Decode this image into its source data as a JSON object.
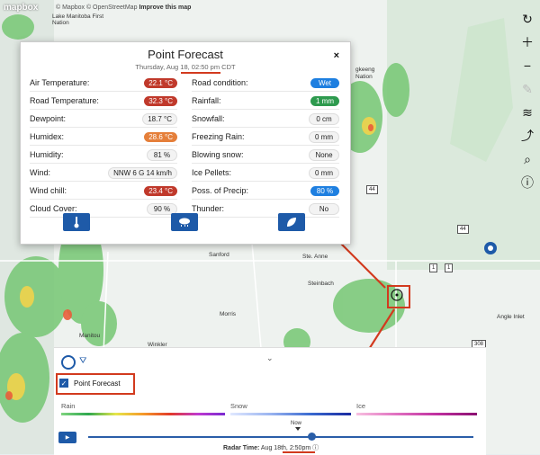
{
  "map": {
    "logo_text": "mapbox",
    "attribution": "© Mapbox © OpenStreetMap",
    "improve_link": "Improve this map",
    "towns": [
      {
        "name": "Lake Manitoba First Nation"
      },
      {
        "name": "Sanford"
      },
      {
        "name": "Ste. Anne"
      },
      {
        "name": "Steinbach"
      },
      {
        "name": "Morris"
      },
      {
        "name": "Manitou"
      },
      {
        "name": "Winkler"
      },
      {
        "name": "Angle Inlet"
      },
      {
        "name": "Nation"
      },
      {
        "name": "gkeeng"
      }
    ],
    "shields": [
      "44",
      "44",
      "1",
      "1",
      "308"
    ]
  },
  "toolbar": {
    "icons": [
      "refresh-icon",
      "zoom-in-icon",
      "zoom-out-icon",
      "pencil-icon",
      "layers-icon",
      "route-icon",
      "search-icon",
      "info-icon"
    ]
  },
  "forecast": {
    "title": "Point Forecast",
    "subtitle": "Thursday, Aug 18, 02:50 pm CDT",
    "close_label": "×",
    "left_rows": [
      {
        "label": "Air Temperature:",
        "value": "22.1 °C",
        "style": "red"
      },
      {
        "label": "Road Temperature:",
        "value": "32.3 °C",
        "style": "red"
      },
      {
        "label": "Dewpoint:",
        "value": "18.7 °C",
        "style": "plain"
      },
      {
        "label": "Humidex:",
        "value": "28.6 °C",
        "style": "orange"
      },
      {
        "label": "Humidity:",
        "value": "81 %",
        "style": "plain"
      },
      {
        "label": "Wind:",
        "value": "NNW 6 G 14 km/h",
        "style": "plain"
      },
      {
        "label": "Wind chill:",
        "value": "23.4 °C",
        "style": "red"
      },
      {
        "label": "Cloud Cover:",
        "value": "90 %",
        "style": "plain"
      }
    ],
    "right_rows": [
      {
        "label": "Road condition:",
        "value": "Wet",
        "style": "blue"
      },
      {
        "label": "Rainfall:",
        "value": "1 mm",
        "style": "green"
      },
      {
        "label": "Snowfall:",
        "value": "0 cm",
        "style": "plain"
      },
      {
        "label": "Freezing Rain:",
        "value": "0 mm",
        "style": "plain"
      },
      {
        "label": "Blowing snow:",
        "value": "None",
        "style": "plain"
      },
      {
        "label": "Ice Pellets:",
        "value": "0 mm",
        "style": "plain"
      },
      {
        "label": "Poss. of Precip:",
        "value": "80 %",
        "style": "blue"
      },
      {
        "label": "Thunder:",
        "value": "No",
        "style": "plain"
      }
    ]
  },
  "bottom": {
    "point_forecast_label": "Point Forecast",
    "scales": {
      "rain": "Rain",
      "snow": "Snow",
      "ice": "Ice"
    },
    "now_label": "Now",
    "radar_time_label": "Radar Time:",
    "radar_time_value": "Aug 18th, 2:50pm",
    "timeline_fraction": 0.58
  },
  "colors": {
    "accent": "#1e5aa8",
    "highlight": "#d23a1e"
  }
}
